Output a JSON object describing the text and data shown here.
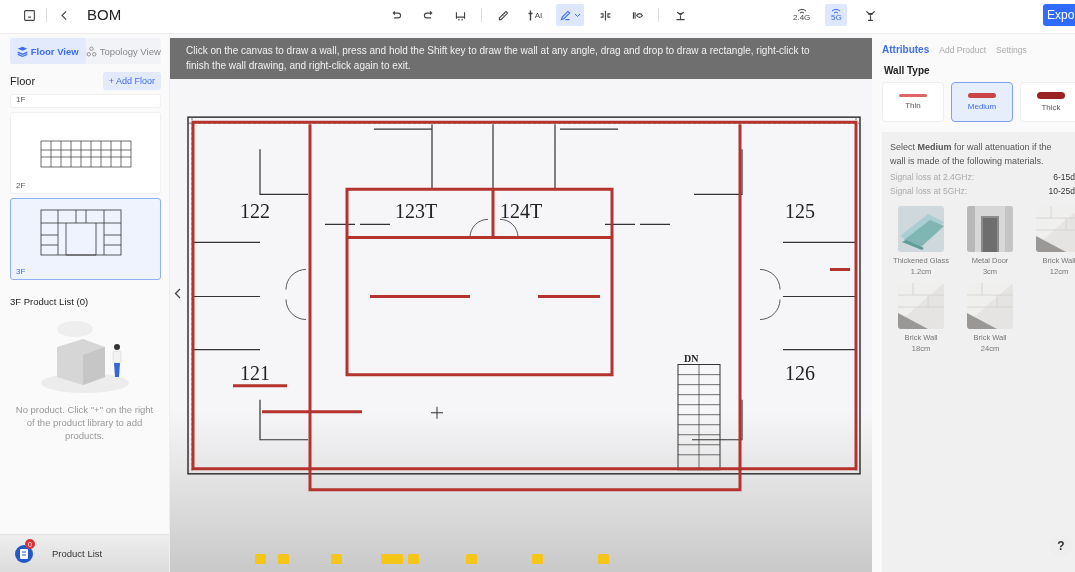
{
  "toolbar": {
    "title": "BOM",
    "left_icons": [
      {
        "kind": "panel"
      },
      {
        "kind": "back"
      }
    ],
    "center_tools": [
      {
        "kind": "undo",
        "selected": false
      },
      {
        "kind": "redo",
        "selected": false
      },
      {
        "kind": "measure",
        "selected": false
      },
      {
        "kind": "divider"
      },
      {
        "kind": "ruler",
        "selected": false
      },
      {
        "kind": "ai",
        "label": "AI",
        "selected": false
      },
      {
        "kind": "pen",
        "selected": true
      },
      {
        "kind": "split",
        "selected": false
      },
      {
        "kind": "eye",
        "selected": false
      },
      {
        "kind": "divider"
      },
      {
        "kind": "signal",
        "selected": false
      }
    ],
    "right_tools": [
      {
        "kind": "band",
        "label": "2.4G",
        "selected": false
      },
      {
        "kind": "band",
        "label": "5G",
        "selected": true
      },
      {
        "kind": "antenna",
        "selected": false
      }
    ],
    "export_button": "Expo"
  },
  "sidebar": {
    "view_tabs": [
      {
        "label": "Floor View",
        "selected": true
      },
      {
        "label": "Topology View",
        "selected": false
      }
    ],
    "floor_heading": "Floor",
    "add_floor_button": "+ Add Floor",
    "floors": [
      {
        "label": "1F",
        "selected": false
      },
      {
        "label": "2F",
        "selected": false
      },
      {
        "label": "3F",
        "selected": true
      }
    ],
    "product_list_title": "3F Product List (0)",
    "empty_message": "No product. Click \"+\" on the right of the product library to add products.",
    "footer": {
      "label": "Product List",
      "badge": "0"
    }
  },
  "canvas": {
    "hint": "Click on the canvas to draw a wall, press and hold the Shift key to draw the wall at any angle, drag and drop to draw a rectangle, right-click to finish the wall drawing, and right-click again to exit.",
    "rooms": [
      {
        "label": "122"
      },
      {
        "label": "123T"
      },
      {
        "label": "124T"
      },
      {
        "label": "125"
      },
      {
        "label": "121"
      },
      {
        "label": "126"
      },
      {
        "label": "DN"
      }
    ],
    "help_button": "?"
  },
  "panel": {
    "tabs": [
      {
        "label": "Attributes",
        "selected": true
      },
      {
        "label": "Add Product",
        "selected": false
      },
      {
        "label": "Settings",
        "selected": false
      }
    ],
    "wall_type_heading": "Wall Type",
    "wall_types": [
      {
        "label": "Thin",
        "color": "#e06666",
        "selected": false
      },
      {
        "label": "Medium",
        "color": "#c94444",
        "selected": true
      },
      {
        "label": "Thick",
        "color": "#9b2222",
        "selected": false
      }
    ],
    "description": "Select **Medium** for wall attenuation if the wall is made of the following materials.",
    "losses": [
      {
        "label": "Signal loss at 2.4GHz:",
        "value": "6-15d"
      },
      {
        "label": "Signal loss at 5GHz:",
        "value": "10-25d"
      }
    ],
    "materials": [
      {
        "kind": "glass",
        "name": "Thickened Glass",
        "thickness": "1.2cm"
      },
      {
        "kind": "door",
        "name": "Metal Door",
        "thickness": "3cm"
      },
      {
        "kind": "brick",
        "name": "Brick Wall",
        "thickness": "12cm"
      },
      {
        "kind": "brick",
        "name": "Brick Wall",
        "thickness": "18cm"
      },
      {
        "kind": "brick",
        "name": "Brick Wall",
        "thickness": "24cm"
      }
    ]
  }
}
